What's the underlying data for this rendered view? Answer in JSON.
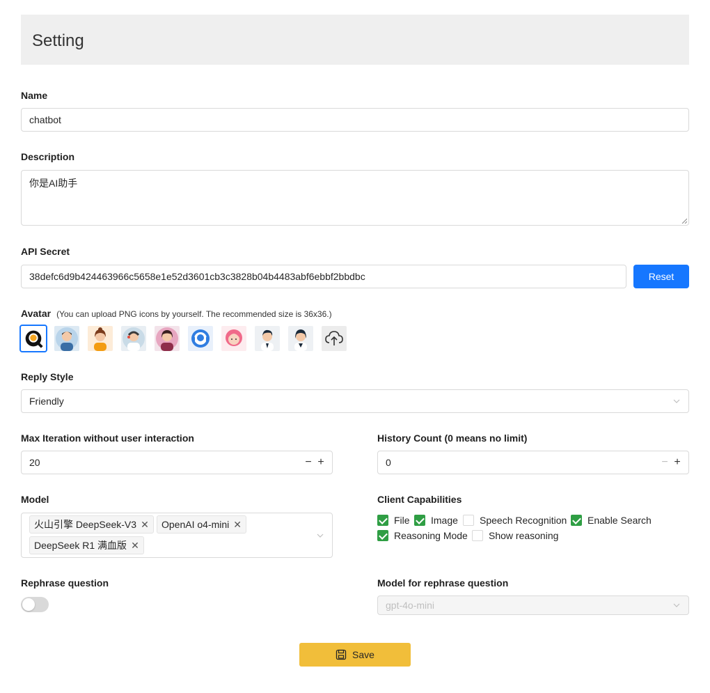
{
  "header": {
    "title": "Setting"
  },
  "name": {
    "label": "Name",
    "value": "chatbot"
  },
  "description": {
    "label": "Description",
    "value": "你是AI助手"
  },
  "api_secret": {
    "label": "API Secret",
    "value": "38defc6d9b424463966c5658e1e52d3601cb3c3828b04b4483abf6ebbf2bbdbc",
    "reset_label": "Reset"
  },
  "avatar": {
    "label": "Avatar",
    "hint": "(You can upload PNG icons by yourself. The recommended size is 36x36.)",
    "items": [
      "search-avatar-icon",
      "businessman-avatar-icon",
      "woman-avatar-icon",
      "support-man-avatar-icon",
      "support-woman-avatar-icon",
      "headset-avatar-icon",
      "pink-agent-avatar-icon",
      "agent-man-avatar-icon",
      "agent-woman-avatar-icon",
      "upload-cloud-icon"
    ],
    "selected_index": 0
  },
  "reply_style": {
    "label": "Reply Style",
    "value": "Friendly"
  },
  "max_iteration": {
    "label": "Max Iteration without user interaction",
    "value": "20"
  },
  "history_count": {
    "label": "History Count (0 means no limit)",
    "value": "0"
  },
  "model": {
    "label": "Model",
    "tags": [
      "火山引擎 DeepSeek-V3",
      "OpenAI o4-mini",
      "DeepSeek R1 满血版"
    ]
  },
  "client_capabilities": {
    "label": "Client Capabilities",
    "options": [
      {
        "label": "File",
        "checked": true
      },
      {
        "label": "Image",
        "checked": true
      },
      {
        "label": "Speech Recognition",
        "checked": false
      },
      {
        "label": "Enable Search",
        "checked": true
      },
      {
        "label": "Reasoning Mode",
        "checked": true
      },
      {
        "label": "Show reasoning",
        "checked": false
      }
    ]
  },
  "rephrase_question": {
    "label": "Rephrase question",
    "enabled": false
  },
  "rephrase_model": {
    "label": "Model for rephrase question",
    "value": "gpt-4o-mini"
  },
  "save": {
    "label": "Save"
  },
  "colors": {
    "primary": "#1677ff",
    "save": "#f1be3a",
    "check": "#2f9e44",
    "header_bg": "#efefef"
  }
}
